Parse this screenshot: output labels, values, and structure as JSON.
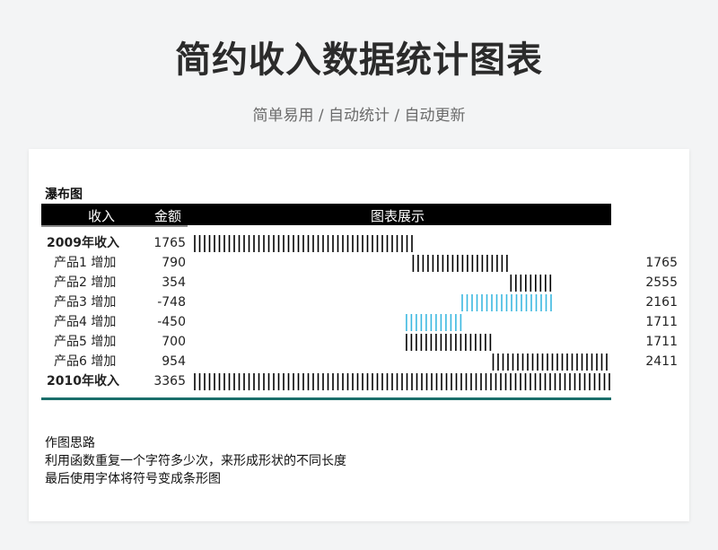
{
  "page": {
    "title": "简约收入数据统计图表",
    "subtitle": "简单易用 / 自动统计 / 自动更新"
  },
  "card": {
    "section_title": "瀑布图",
    "columns": [
      "收入",
      "金额",
      "图表展示"
    ],
    "notes": [
      "作图思路",
      "利用函数重复一个字符多少次，来形成形状的不同长度",
      "最后使用字体将符号变成条形图"
    ]
  },
  "colors": {
    "bar": "#000000",
    "negative_bar": "#3bb8e0",
    "header_bg": "#000000",
    "base_line": "#1a6e6b"
  },
  "chart_data": {
    "type": "bar",
    "subtype": "waterfall",
    "categories": [
      "2009年收入",
      "产品1 增加",
      "产品2 增加",
      "产品3 增加",
      "产品4 增加",
      "产品5 增加",
      "产品6 增加",
      "2010年收入"
    ],
    "values": [
      1765,
      790,
      354,
      -748,
      -450,
      700,
      954,
      3365
    ],
    "cumulative_labels": [
      "",
      "1765",
      "2555",
      "2161",
      "1711",
      "1711",
      "2411",
      ""
    ],
    "bold_rows": [
      0,
      7
    ],
    "xlim": [
      0,
      3365
    ],
    "bars": [
      {
        "start": 0,
        "end": 1765,
        "negative": false
      },
      {
        "start": 1765,
        "end": 2555,
        "negative": false
      },
      {
        "start": 2555,
        "end": 2909,
        "negative": false
      },
      {
        "start": 2161,
        "end": 2909,
        "negative": true
      },
      {
        "start": 1711,
        "end": 2161,
        "negative": true
      },
      {
        "start": 1711,
        "end": 2411,
        "negative": false
      },
      {
        "start": 2411,
        "end": 3365,
        "negative": false
      },
      {
        "start": 0,
        "end": 3365,
        "negative": false
      }
    ]
  }
}
